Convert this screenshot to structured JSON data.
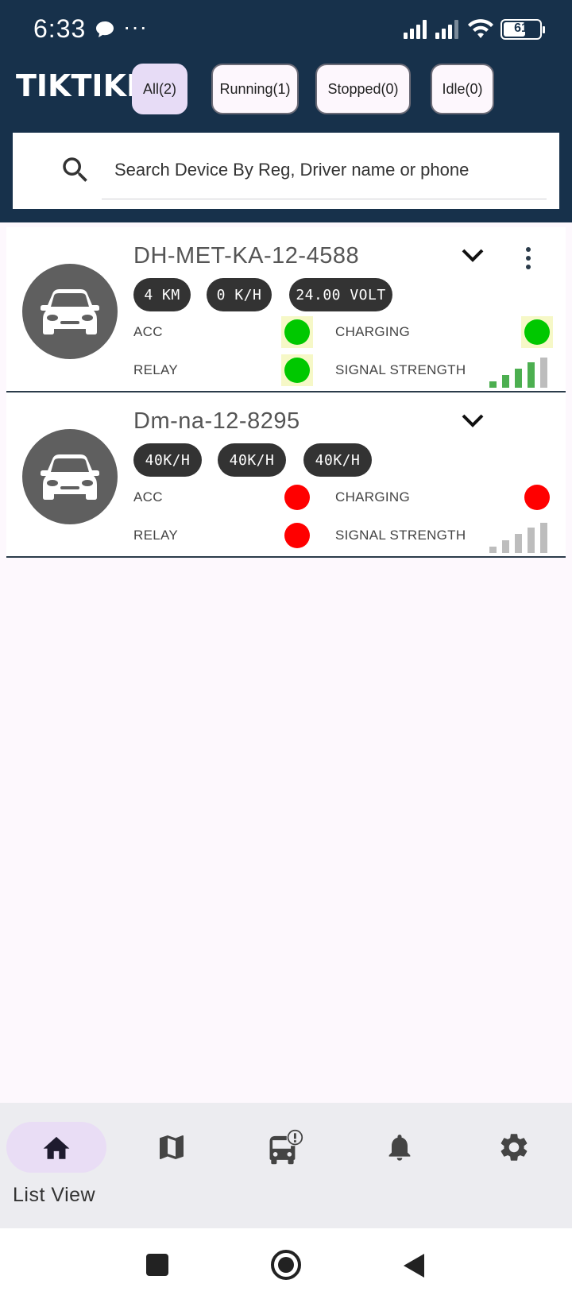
{
  "status_bar": {
    "time": "6:33",
    "dots": "···",
    "battery": "61",
    "battery_level": 0.61
  },
  "header": {
    "logo": "TIKTIKI",
    "filters": [
      {
        "label": "All(2)",
        "active": true
      },
      {
        "label": "Running(1)",
        "active": false
      },
      {
        "label": "Stopped(0)",
        "active": false
      },
      {
        "label": "Idle(0)",
        "active": false
      }
    ],
    "search": {
      "placeholder": "Search Device By Reg, Driver name or phone"
    }
  },
  "devices": [
    {
      "reg": "DH-MET-KA-12-4588",
      "stats": [
        "4 KM",
        "0 K/H",
        "24.00 VOLT"
      ],
      "acc_label": "ACC",
      "acc_color": "#00c800",
      "charging_label": "CHARGING",
      "charging_color": "#00c800",
      "relay_label": "RELAY",
      "relay_color": "#00c800",
      "signal_label": "SIGNAL STRENGTH",
      "signal_bars": 4,
      "signal_color": "#4caf50",
      "has_menu": true
    },
    {
      "reg": "Dm-na-12-8295",
      "stats": [
        "40K/H",
        "40K/H",
        "40K/H"
      ],
      "acc_label": "ACC",
      "acc_color": "#ff0000",
      "charging_label": "CHARGING",
      "charging_color": "#ff0000",
      "relay_label": "RELAY",
      "relay_color": "#ff0000",
      "signal_label": "SIGNAL STRENGTH",
      "signal_bars": 0,
      "signal_color": "#bdbdbd",
      "has_menu": false
    }
  ],
  "bottom_nav": {
    "items": [
      {
        "icon": "home-icon",
        "label": "List View",
        "active": true
      },
      {
        "icon": "map-icon",
        "label": "",
        "active": false
      },
      {
        "icon": "bus-alert-icon",
        "label": "",
        "active": false
      },
      {
        "icon": "bell-icon",
        "label": "",
        "active": false
      },
      {
        "icon": "gear-icon",
        "label": "",
        "active": false
      }
    ]
  },
  "colors": {
    "header_bg": "#17314b",
    "active_chip": "#e7dcf6",
    "status_on": "#00c800",
    "status_off": "#ff0000"
  }
}
